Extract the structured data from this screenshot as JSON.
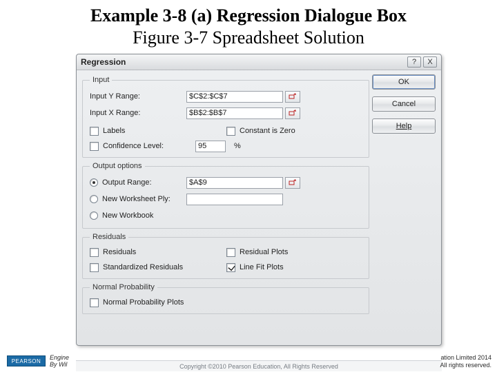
{
  "slide": {
    "title_line1": "Example 3-8 (a) Regression Dialogue Box",
    "title_line2": "Figure 3-7 Spreadsheet Solution"
  },
  "dialog": {
    "title": "Regression",
    "help_icon": "?",
    "close_icon": "X",
    "buttons": {
      "ok": "OK",
      "cancel": "Cancel",
      "help": "Help"
    },
    "input_group": {
      "legend": "Input",
      "y_label": "Input Y Range:",
      "y_value": "$C$2:$C$7",
      "x_label": "Input X Range:",
      "x_value": "$B$2:$B$7",
      "labels_chk": "Labels",
      "const_chk": "Constant is Zero",
      "conf_chk": "Confidence Level:",
      "conf_value": "95",
      "conf_suffix": "%"
    },
    "output_group": {
      "legend": "Output options",
      "out_range": "Output Range:",
      "out_range_value": "$A$9",
      "new_sheet": "New Worksheet Ply:",
      "new_book": "New Workbook"
    },
    "residuals_group": {
      "legend": "Residuals",
      "residuals": "Residuals",
      "std_residuals": "Standardized Residuals",
      "residual_plots": "Residual Plots",
      "line_fit_plots": "Line Fit Plots"
    },
    "normal_group": {
      "legend": "Normal Probability",
      "normal_plots": "Normal Probability Plots"
    },
    "strip": "Copyright ©2010 Pearson Education, All Rights Reserved"
  },
  "footer": {
    "logo": "PEARSON",
    "left1": "Engine",
    "left2": "By Wil",
    "right1": "ation Limited 2014",
    "right2": "All rights reserved."
  }
}
